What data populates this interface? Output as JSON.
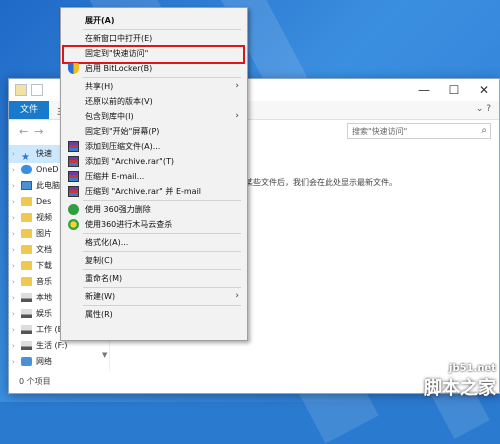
{
  "menu": {
    "items": [
      {
        "label": "展开(A)",
        "bold": true,
        "icon": "",
        "arrow": false
      },
      {
        "sep": true
      },
      {
        "label": "在新窗口中打开(E)",
        "icon": "",
        "arrow": false
      },
      {
        "label": "固定到\"快速访问\"",
        "icon": "",
        "arrow": false,
        "highlighted": true
      },
      {
        "label": "启用 BitLocker(B)",
        "icon": "shield-icon",
        "arrow": false
      },
      {
        "sep": true
      },
      {
        "label": "共享(H)",
        "icon": "",
        "arrow": true
      },
      {
        "label": "还原以前的版本(V)",
        "icon": "",
        "arrow": false
      },
      {
        "label": "包含到库中(I)",
        "icon": "",
        "arrow": true
      },
      {
        "label": "固定到\"开始\"屏幕(P)",
        "icon": "",
        "arrow": false
      },
      {
        "label": "添加到压缩文件(A)...",
        "icon": "winrar-icon",
        "arrow": false
      },
      {
        "label": "添加到 \"Archive.rar\"(T)",
        "icon": "winrar-icon",
        "arrow": false
      },
      {
        "label": "压缩并 E-mail...",
        "icon": "winrar-icon",
        "arrow": false
      },
      {
        "label": "压缩到 \"Archive.rar\" 并 E-mail",
        "icon": "winrar-icon",
        "arrow": false
      },
      {
        "sep": true
      },
      {
        "label": "使用 360强力删除",
        "icon": "360-delete-icon",
        "arrow": false
      },
      {
        "label": "使用360进行木马云查杀",
        "icon": "360-scan-icon",
        "arrow": false
      },
      {
        "sep": true
      },
      {
        "label": "格式化(A)...",
        "icon": "",
        "arrow": false
      },
      {
        "sep": true
      },
      {
        "label": "复制(C)",
        "icon": "",
        "arrow": false
      },
      {
        "sep": true
      },
      {
        "label": "重命名(M)",
        "icon": "",
        "arrow": false
      },
      {
        "sep": true
      },
      {
        "label": "新建(W)",
        "icon": "",
        "arrow": true
      },
      {
        "sep": true
      },
      {
        "label": "属性(R)",
        "icon": "",
        "arrow": false
      }
    ]
  },
  "window": {
    "ribbon_file_tab": "文件",
    "ribbon_partial": "主",
    "search_placeholder": "搜索\"快速访问\"",
    "empty_message": "某些文件后，我们会在此处显示最新文件。",
    "status": "0 个项目",
    "win_min": "—",
    "win_max": "☐",
    "win_close": "✕"
  },
  "sidebar": [
    {
      "label": "快速",
      "icon": "star-icon",
      "selected": true
    },
    {
      "label": "OneD",
      "icon": "cloud-icon"
    },
    {
      "label": "此电脑",
      "icon": "pc-icon"
    },
    {
      "label": "Des",
      "icon": "folder-icon"
    },
    {
      "label": "视频",
      "icon": "folder-icon"
    },
    {
      "label": "图片",
      "icon": "folder-icon"
    },
    {
      "label": "文档",
      "icon": "folder-icon"
    },
    {
      "label": "下载",
      "icon": "folder-icon"
    },
    {
      "label": "音乐",
      "icon": "folder-icon"
    },
    {
      "label": "本地",
      "icon": "drive-icon"
    },
    {
      "label": "娱乐",
      "icon": "drive-icon"
    },
    {
      "label": "工作 (E:)",
      "icon": "drive-icon"
    },
    {
      "label": "生活 (F:)",
      "icon": "drive-icon"
    },
    {
      "label": "网络",
      "icon": "network-icon"
    }
  ],
  "watermark": {
    "url": "jb51.net",
    "name": "脚本之家"
  }
}
